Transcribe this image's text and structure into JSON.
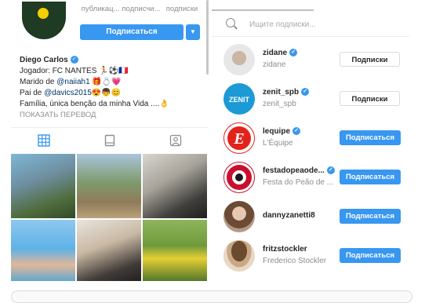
{
  "profile": {
    "stats": [
      {
        "value": "",
        "label": "публикац..."
      },
      {
        "value": "",
        "label": "подписчи..."
      },
      {
        "value": "",
        "label": "подписки"
      }
    ],
    "subscribe_label": "Подписаться",
    "dropdown_icon": "chevron-down-icon",
    "name": "Diego Carlos",
    "bio_line1": "Jogador: FC NANTES 🏃⚽🇫🇷",
    "bio_line2_prefix": "Marido de ",
    "bio_line2_link": "@naiiah1",
    "bio_line2_suffix": " 🎁💍💗",
    "bio_line3_prefix": "Pai de ",
    "bio_line3_link": "@davics2015",
    "bio_line3_suffix": "😍👦😊",
    "bio_line4": "Família, única benção da minha Vida ....👌",
    "translate_label": "ПОКАЗАТЬ ПЕРЕВОД",
    "tabs": [
      {
        "icon": "grid-icon",
        "glyph": "▦"
      },
      {
        "icon": "feed-icon",
        "glyph": "▭"
      },
      {
        "icon": "tagged-icon",
        "glyph": "👤"
      }
    ]
  },
  "search": {
    "placeholder": "Ищите подписки..."
  },
  "following": [
    {
      "username": "zidane",
      "fullname": "zidane",
      "verified": true,
      "button": "Подписки",
      "button_style": "following",
      "avatar_color": "#d9d9d9"
    },
    {
      "username": "zenit_spb",
      "fullname": "zenit_spb",
      "verified": true,
      "button": "Подписки",
      "button_style": "following",
      "avatar_color": "#1c9ad6"
    },
    {
      "username": "lequipe",
      "fullname": "L'Équipe",
      "verified": true,
      "button": "Подписаться",
      "button_style": "follow",
      "avatar_color": "#e2231a"
    },
    {
      "username": "festadopeaode...",
      "fullname": "Festa do Peão de ...",
      "verified": true,
      "button": "Подписаться",
      "button_style": "follow",
      "avatar_color": "#c8102e"
    },
    {
      "username": "dannyzanetti8",
      "fullname": "",
      "verified": false,
      "button": "Подписаться",
      "button_style": "follow",
      "avatar_color": "#a0846c"
    },
    {
      "username": "fritzstockler",
      "fullname": "Frederico Stockler",
      "verified": false,
      "button": "Подписаться",
      "button_style": "follow",
      "avatar_color": "#8a6a4f"
    }
  ],
  "colors": {
    "accent": "#3897f0",
    "text": "#262626",
    "muted": "#8e8e8e"
  }
}
